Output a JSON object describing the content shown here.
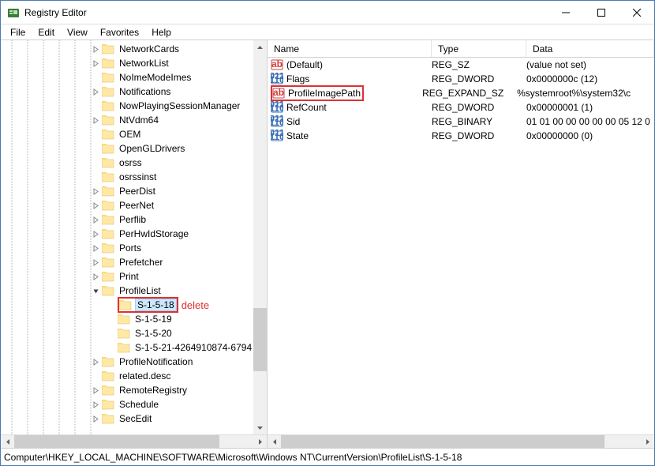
{
  "window": {
    "title": "Registry Editor"
  },
  "menu": {
    "file": "File",
    "edit": "Edit",
    "view": "View",
    "favorites": "Favorites",
    "help": "Help"
  },
  "tree": {
    "items": [
      {
        "indent": 128,
        "expand": "right",
        "label": "NetworkCards"
      },
      {
        "indent": 128,
        "expand": "right",
        "label": "NetworkList"
      },
      {
        "indent": 128,
        "expand": "none",
        "label": "NoImeModeImes"
      },
      {
        "indent": 128,
        "expand": "right",
        "label": "Notifications"
      },
      {
        "indent": 128,
        "expand": "none",
        "label": "NowPlayingSessionManager"
      },
      {
        "indent": 128,
        "expand": "right",
        "label": "NtVdm64"
      },
      {
        "indent": 128,
        "expand": "none",
        "label": "OEM"
      },
      {
        "indent": 128,
        "expand": "none",
        "label": "OpenGLDrivers"
      },
      {
        "indent": 128,
        "expand": "none",
        "label": "osrss"
      },
      {
        "indent": 128,
        "expand": "none",
        "label": "osrssinst"
      },
      {
        "indent": 128,
        "expand": "right",
        "label": "PeerDist"
      },
      {
        "indent": 128,
        "expand": "right",
        "label": "PeerNet"
      },
      {
        "indent": 128,
        "expand": "right",
        "label": "Perflib"
      },
      {
        "indent": 128,
        "expand": "right",
        "label": "PerHwIdStorage"
      },
      {
        "indent": 128,
        "expand": "right",
        "label": "Ports"
      },
      {
        "indent": 128,
        "expand": "right",
        "label": "Prefetcher"
      },
      {
        "indent": 128,
        "expand": "right",
        "label": "Print"
      },
      {
        "indent": 128,
        "expand": "down",
        "label": "ProfileList"
      },
      {
        "indent": 148,
        "expand": "none",
        "label": "S-1-5-18",
        "highlight": true,
        "selected": true,
        "annotation": "delete"
      },
      {
        "indent": 148,
        "expand": "none",
        "label": "S-1-5-19"
      },
      {
        "indent": 148,
        "expand": "none",
        "label": "S-1-5-20"
      },
      {
        "indent": 148,
        "expand": "none",
        "label": "S-1-5-21-4264910874-6794"
      },
      {
        "indent": 128,
        "expand": "right",
        "label": "ProfileNotification"
      },
      {
        "indent": 128,
        "expand": "none",
        "label": "related.desc"
      },
      {
        "indent": 128,
        "expand": "right",
        "label": "RemoteRegistry"
      },
      {
        "indent": 128,
        "expand": "right",
        "label": "Schedule"
      },
      {
        "indent": 128,
        "expand": "right",
        "label": "SecEdit"
      }
    ]
  },
  "list": {
    "headers": {
      "name": "Name",
      "type": "Type",
      "data": "Data"
    },
    "rows": [
      {
        "icon": "str",
        "name": "(Default)",
        "type": "REG_SZ",
        "data": "(value not set)"
      },
      {
        "icon": "bin",
        "name": "Flags",
        "type": "REG_DWORD",
        "data": "0x0000000c (12)"
      },
      {
        "icon": "str",
        "name": "ProfileImagePath",
        "type": "REG_EXPAND_SZ",
        "data": "%systemroot%\\system32\\c",
        "highlight": true
      },
      {
        "icon": "bin",
        "name": "RefCount",
        "type": "REG_DWORD",
        "data": "0x00000001 (1)"
      },
      {
        "icon": "bin",
        "name": "Sid",
        "type": "REG_BINARY",
        "data": "01 01 00 00 00 00 00 05 12 0"
      },
      {
        "icon": "bin",
        "name": "State",
        "type": "REG_DWORD",
        "data": "0x00000000 (0)"
      }
    ]
  },
  "statusbar": {
    "path": "Computer\\HKEY_LOCAL_MACHINE\\SOFTWARE\\Microsoft\\Windows NT\\CurrentVersion\\ProfileList\\S-1-5-18"
  }
}
